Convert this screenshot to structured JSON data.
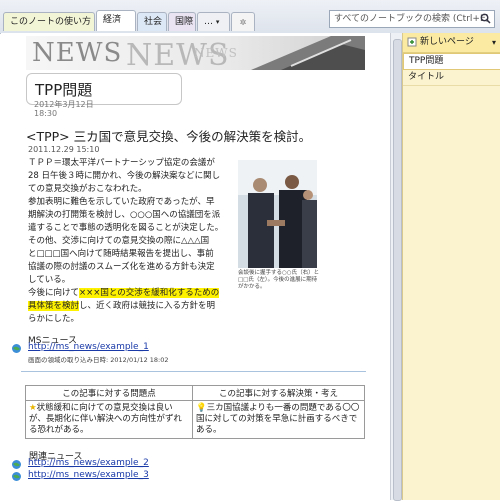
{
  "tabs": [
    {
      "label": "このノートの使い方"
    },
    {
      "label": "経済"
    },
    {
      "label": "社会"
    },
    {
      "label": "国際"
    },
    {
      "label": "…"
    }
  ],
  "search": {
    "placeholder": "すべてのノートブックの検索 (Ctrl+E)"
  },
  "right_panel": {
    "new_page_label": "新しいページ",
    "pages": [
      {
        "label": "TPP問題"
      },
      {
        "label": "タイトル"
      }
    ]
  },
  "note": {
    "banner_word": "NEWS",
    "title": "TPP問題",
    "date": "2012年3月12日",
    "time": "18:30",
    "headline": "<TPP> 三カ国で意見交換、今後の解決策を検討。",
    "article_date": "2011.12.29 15:10",
    "body_lines": [
      "ＴＰＰ＝環太平洋パートナーシップ協定の会議が",
      "28 日午後３時に開かれ、今後の解決案などに関し",
      "ての意見交換がおこなわれた。",
      "参加表明に難色を示していた政府であったが、早",
      "期解決の打開策を検討し、○○○国への協議団を派",
      "遣することで事態の透明化を図ることが決定した。",
      "その他、交渉に向けての意見交換の際に△△△国",
      "と□□□国へ向けて随時結果報告を提出し、事前",
      "協議の際の討議のスムーズ化を進める方針も決定",
      "している。"
    ],
    "hl_prefix": "今後に向けて",
    "hl_text_1": "×××国との交渉を緩和化するための",
    "hl_text_2": "具体策を検討",
    "hl_suffix": "し、近く政府は競技に入る方針を明",
    "last_line": "らかにした。",
    "caption": "会談後に握手する○○氏（右）と□□氏（左）。今後の進展に期待がかかる。",
    "source_name": "MSニュース",
    "source_link": "http://ms_news/example_1",
    "clip_date": "画面の領域の取り込み日時: 2012/01/12 18:02",
    "table": {
      "headers": [
        "この記事に対する問題点",
        "この記事に対する解決策・考え"
      ],
      "left": "状態緩和に向けての意見交換は良いが、長期化に伴い解決への方向性がずれる恐れがある。",
      "right": "三カ国協議よりも一番の問題である〇〇国に対しての対策を早急に計画するべきである。"
    },
    "related_title": "関連ニュース",
    "related_links": [
      "http://ms_news/example_2",
      "http://ms_news/example_3"
    ]
  }
}
